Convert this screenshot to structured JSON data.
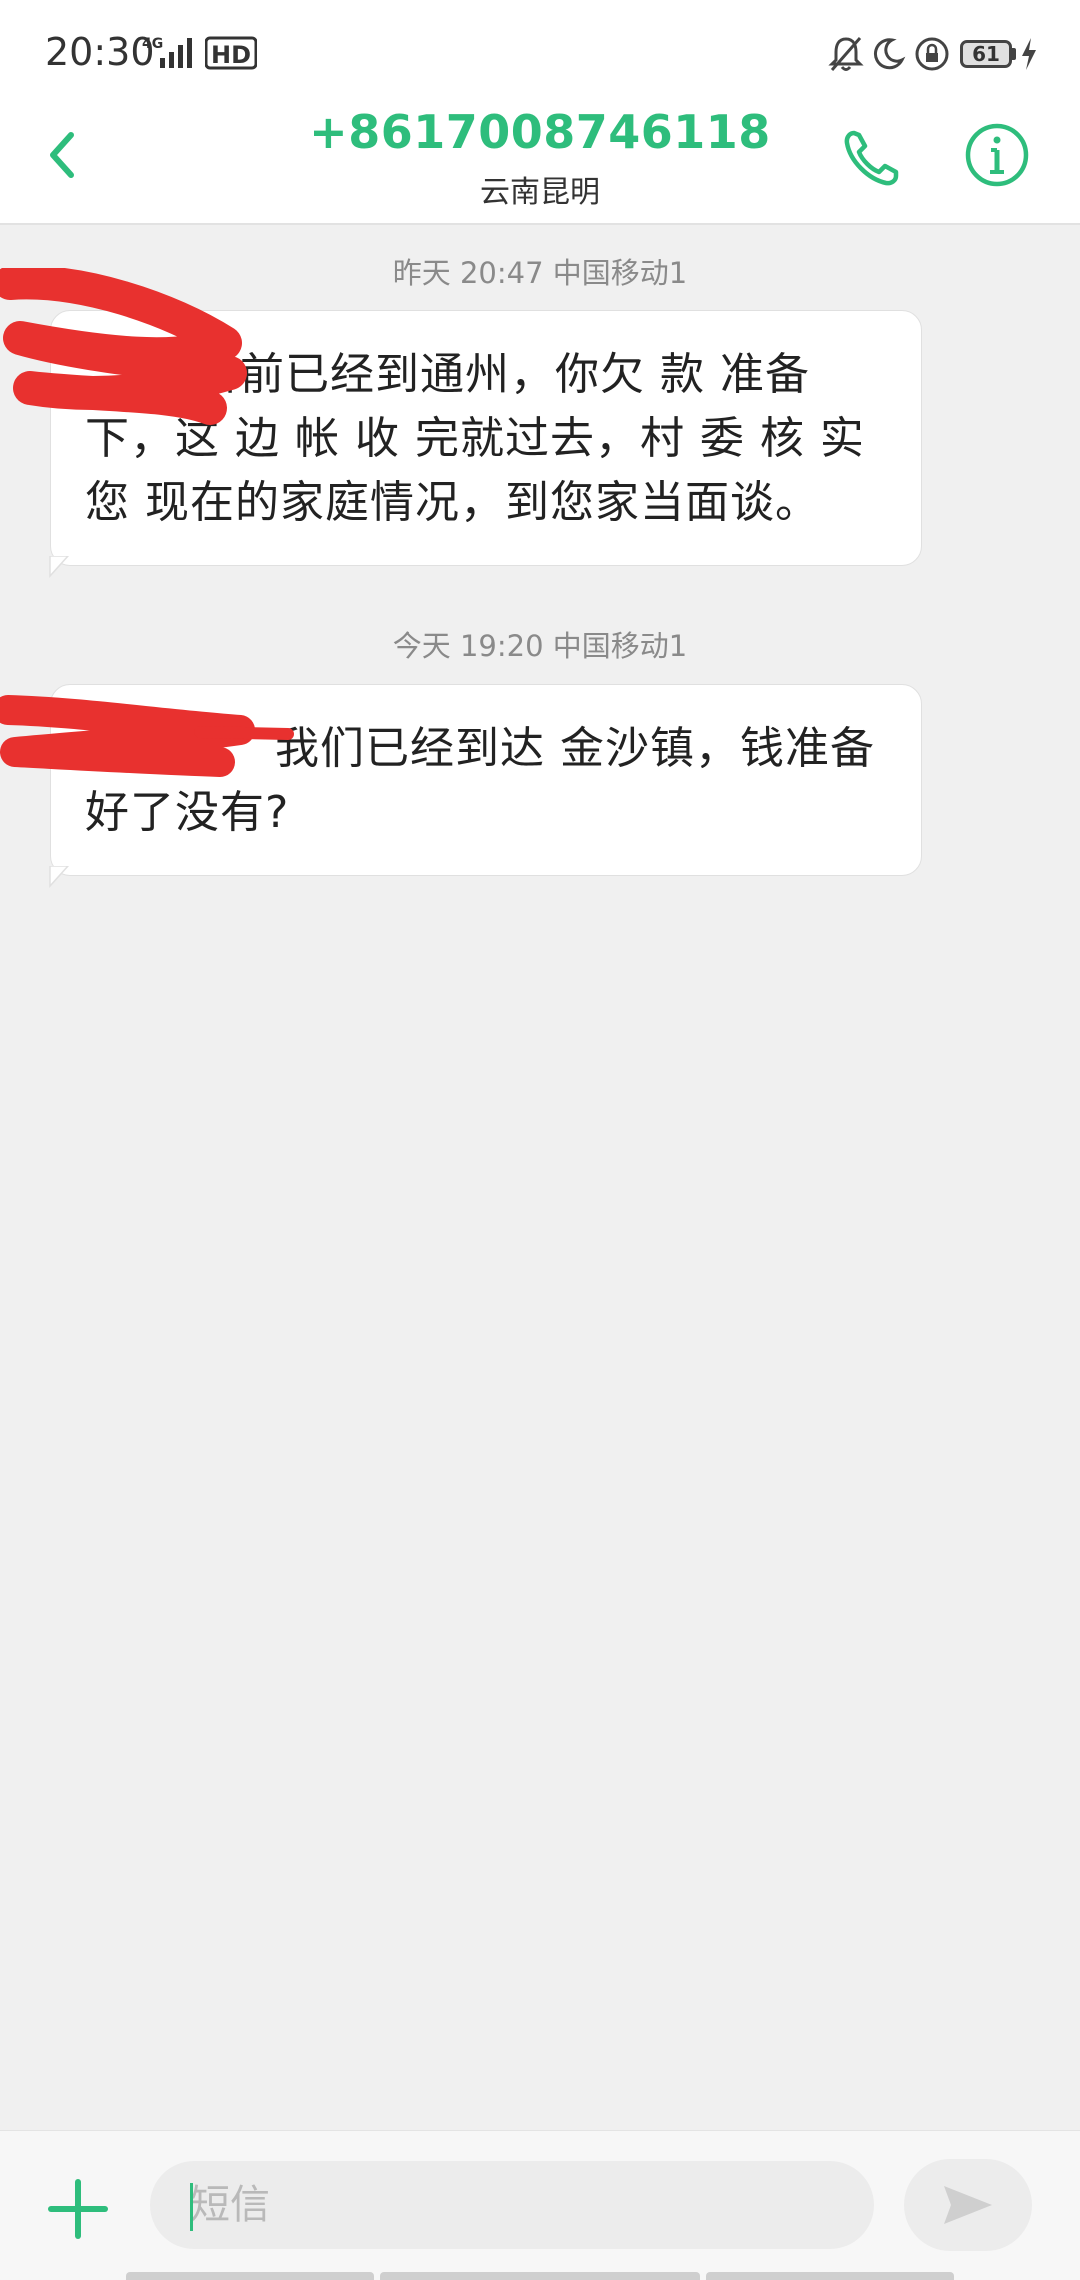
{
  "status_bar": {
    "time": "20:30",
    "network": "4G",
    "hd_label": "HD",
    "battery": "61"
  },
  "header": {
    "contact_number": "+8617008746118",
    "contact_location": "云南昆明"
  },
  "messages": [
    {
      "time_label": "昨天 20:47  中国移动1",
      "text": "目前已经到通州，你欠 款 准备下，这 边 帐 收 完就过去，村 委 核 实 您 现在的家庭情况，到您家当面谈。"
    },
    {
      "time_label": "今天 19:20  中国移动1",
      "text": "我们已经到达 金沙镇，钱准备好了没有?"
    }
  ],
  "composer": {
    "placeholder": "短信"
  },
  "colors": {
    "accent": "#2ebd7c",
    "background": "#f0f0f0",
    "bubble": "#ffffff",
    "redaction": "#e8312f"
  },
  "icons": {
    "back": "chevron-left-icon",
    "call": "phone-icon",
    "info": "info-icon",
    "add": "plus-icon",
    "send": "send-icon"
  }
}
